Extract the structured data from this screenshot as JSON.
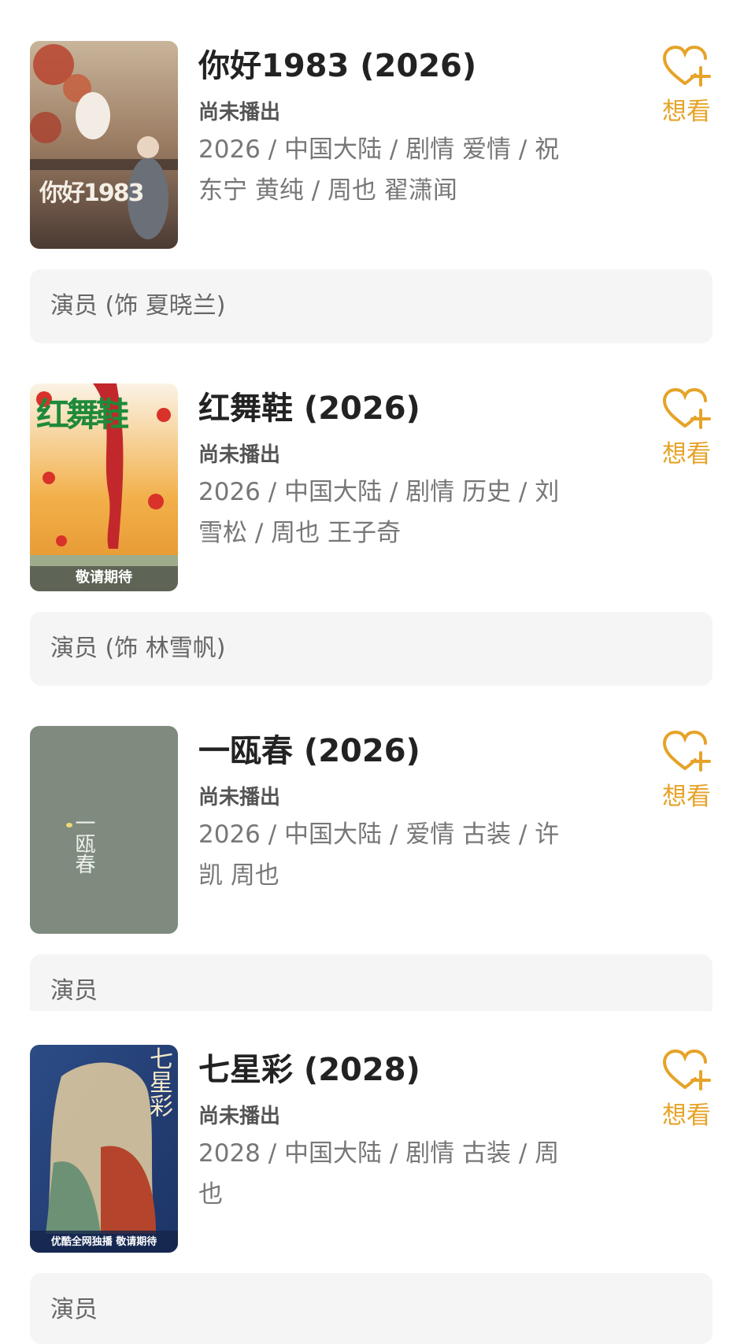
{
  "want_label": "想看",
  "colors": {
    "accent": "#e6a328",
    "title": "#222222",
    "meta": "#777777",
    "role_bg": "#f5f5f5"
  },
  "items": [
    {
      "title": "你好1983 (2026)",
      "status": "尚未播出",
      "meta": "2026 / 中国大陆 / 剧情 爱情 / 祝东宁 黄纯 / 周也 翟潇闻",
      "role": "演员 (饰 夏晓兰)",
      "poster_text": "你好1983"
    },
    {
      "title": "红舞鞋 (2026)",
      "status": "尚未播出",
      "meta": "2026 / 中国大陆 / 剧情 历史 / 刘雪松 / 周也 王子奇",
      "role": "演员 (饰 林雪帆)",
      "poster_text": "红舞鞋",
      "poster_footer": "敬请期待"
    },
    {
      "title": "一瓯春 (2026)",
      "status": "尚未播出",
      "meta": "2026 / 中国大陆 / 爱情 古装 / 许凯 周也",
      "role": "演员",
      "poster_text": "一瓯春"
    },
    {
      "title": "七星彩 (2028)",
      "status": "尚未播出",
      "meta": "2028 / 中国大陆 / 剧情 古装 / 周也",
      "role": "演员",
      "poster_text": "七星彩",
      "poster_footer": "优酷全网独播 敬请期待"
    }
  ]
}
